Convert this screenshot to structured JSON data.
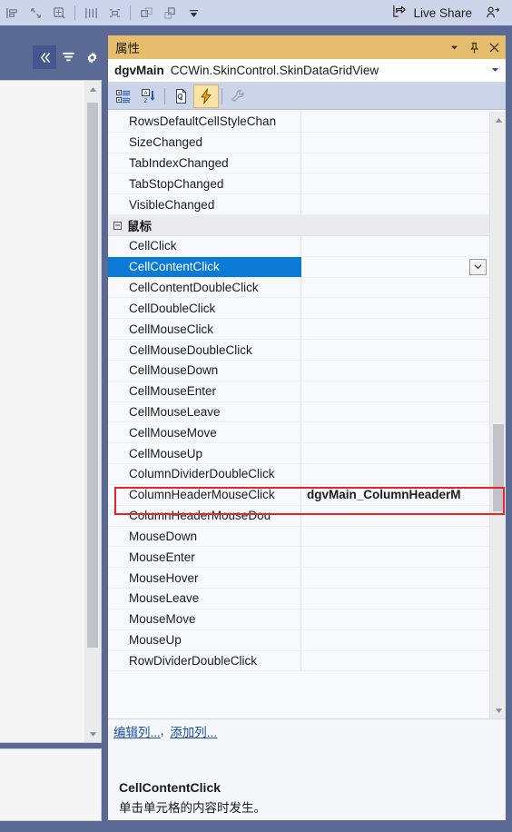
{
  "top_toolbar": {
    "icons": [
      "align-left-icon",
      "resize-icon",
      "zoom-icon",
      "spacing-vertical-icon",
      "spacing-horizontal-icon",
      "bring-to-front-icon",
      "send-to-back-icon",
      "overflow-chevron-icon"
    ],
    "live_share_label": "Live Share",
    "live_share_icon": "live-share-icon",
    "user_icon": "add-user-icon"
  },
  "left_panel": {
    "collapse_icon": "double-chevron-left-icon",
    "filter_icon": "filter-icon",
    "settings_icon": "gear-icon",
    "scroll_up_icon": "scroll-up-arrow-icon",
    "scroll_down_icon": "scroll-down-arrow-icon"
  },
  "properties": {
    "title": "属性",
    "title_buttons": {
      "dropdown": "chevron-down-icon",
      "pin": "pin-icon",
      "close": "close-icon"
    },
    "combo": {
      "object_name": "dgvMain",
      "object_type": "CCWin.SkinControl.SkinDataGridView",
      "arrow_icon": "chevron-down-icon"
    },
    "toolbar": [
      {
        "name": "categorized-button",
        "icon": "categorized-icon",
        "toggled": false
      },
      {
        "name": "alphabetical-button",
        "icon": "sort-az-icon",
        "toggled": false
      },
      {
        "name": "properties-button",
        "icon": "properties-page-icon",
        "toggled": false
      },
      {
        "name": "events-button",
        "icon": "lightning-bolt-icon",
        "toggled": true
      },
      {
        "name": "property-pages-button",
        "icon": "wrench-icon",
        "toggled": false
      }
    ],
    "rows": [
      {
        "name": "RowsDefaultCellStyleChan",
        "value": "",
        "type": "property"
      },
      {
        "name": "SizeChanged",
        "value": "",
        "type": "property"
      },
      {
        "name": "TabIndexChanged",
        "value": "",
        "type": "property"
      },
      {
        "name": "TabStopChanged",
        "value": "",
        "type": "property"
      },
      {
        "name": "VisibleChanged",
        "value": "",
        "type": "property"
      },
      {
        "name": "鼠标",
        "value": "",
        "type": "category",
        "expander": "−"
      },
      {
        "name": "CellClick",
        "value": "",
        "type": "property"
      },
      {
        "name": "CellContentClick",
        "value": "",
        "type": "property",
        "selected": true,
        "has_dropdown": true
      },
      {
        "name": "CellContentDoubleClick",
        "value": "",
        "type": "property"
      },
      {
        "name": "CellDoubleClick",
        "value": "",
        "type": "property"
      },
      {
        "name": "CellMouseClick",
        "value": "",
        "type": "property"
      },
      {
        "name": "CellMouseDoubleClick",
        "value": "",
        "type": "property"
      },
      {
        "name": "CellMouseDown",
        "value": "",
        "type": "property"
      },
      {
        "name": "CellMouseEnter",
        "value": "",
        "type": "property"
      },
      {
        "name": "CellMouseLeave",
        "value": "",
        "type": "property"
      },
      {
        "name": "CellMouseMove",
        "value": "",
        "type": "property"
      },
      {
        "name": "CellMouseUp",
        "value": "",
        "type": "property"
      },
      {
        "name": "ColumnDividerDoubleClick",
        "value": "",
        "type": "property"
      },
      {
        "name": "ColumnHeaderMouseClick",
        "value": "dgvMain_ColumnHeaderM",
        "type": "property",
        "bold_value": true,
        "highlighted": true
      },
      {
        "name": "ColumnHeaderMouseDou",
        "value": "",
        "type": "property"
      },
      {
        "name": "MouseDown",
        "value": "",
        "type": "property"
      },
      {
        "name": "MouseEnter",
        "value": "",
        "type": "property"
      },
      {
        "name": "MouseHover",
        "value": "",
        "type": "property"
      },
      {
        "name": "MouseLeave",
        "value": "",
        "type": "property"
      },
      {
        "name": "MouseMove",
        "value": "",
        "type": "property"
      },
      {
        "name": "MouseUp",
        "value": "",
        "type": "property"
      },
      {
        "name": "RowDividerDoubleClick",
        "value": "",
        "type": "property"
      }
    ],
    "scroll_up_icon": "scroll-up-arrow-icon",
    "scroll_down_icon": "scroll-down-arrow-icon",
    "links": {
      "edit_columns": "编辑列...",
      "separator": ",",
      "add_column": "添加列..."
    },
    "description": {
      "title": "CellContentClick",
      "text": "单击单元格的内容时发生。"
    }
  },
  "colors": {
    "title_bar": "#e5bd6d",
    "selection": "#0b7ad6",
    "highlight_border": "#e8232a",
    "window_chrome": "#5b6a94",
    "toolbar": "#ccd4ea",
    "link": "#1a53b0"
  }
}
